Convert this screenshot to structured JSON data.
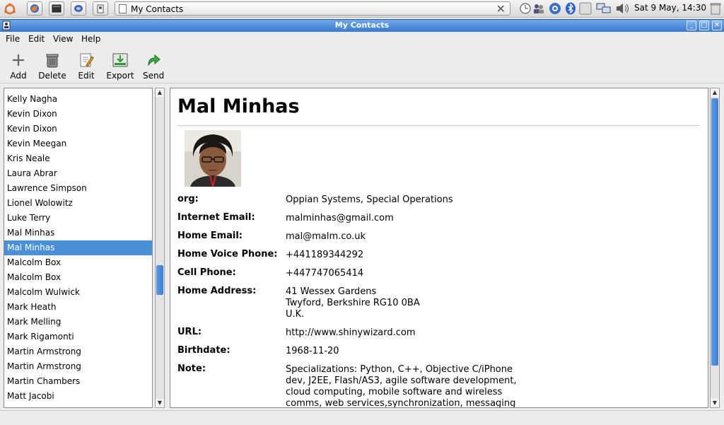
{
  "taskbar": {
    "window_title": "My Contacts",
    "clock": "Sat  9 May, 14:30"
  },
  "window": {
    "title": "My Contacts"
  },
  "menu": {
    "file": "File",
    "edit": "Edit",
    "view": "View",
    "help": "Help"
  },
  "toolbar": {
    "add": "Add",
    "delete": "Delete",
    "edit": "Edit",
    "export": "Export",
    "send": "Send"
  },
  "contacts": [
    "Kelly Nagha",
    "Kevin Dixon",
    "Kevin Dixon",
    "Kevin Meegan",
    "Kris Neale",
    "Laura Abrar",
    "Lawrence Simpson",
    "Lionel Wolowitz",
    "Luke Terry",
    "Mal Minhas",
    "Mal Minhas",
    "Malcolm Box",
    "Malcolm Box",
    "Malcolm Wulwick",
    "Mark Heath",
    "Mark Melling",
    "Mark Rigamonti",
    "Martin Armstrong",
    "Martin Armstrong",
    "Martin Chambers",
    "Matt Jacobi"
  ],
  "detail": {
    "name": "Mal Minhas",
    "fields": [
      {
        "label": "org:",
        "value": "Oppian Systems, Special Operations"
      },
      {
        "label": "Internet Email:",
        "value": "malminhas@gmail.com"
      },
      {
        "label": "Home Email:",
        "value": "mal@malm.co.uk"
      },
      {
        "label": "Home Voice Phone:",
        "value": "+441189344292"
      },
      {
        "label": "Cell Phone:",
        "value": "+447747065414"
      },
      {
        "label": "Home Address:",
        "value": "41 Wessex Gardens",
        "value2": "Twyford, Berkshire RG10 0BA",
        "value3": "U.K."
      },
      {
        "label": "URL:",
        "value": "http://www.shinywizard.com"
      },
      {
        "label": "Birthdate:",
        "value": "1968-11-20"
      },
      {
        "label": "Note:",
        "value": "Specializations: Python, C++, Objective C/iPhone",
        "value2": "dev, J2EE, Flash/AS3, agile software development,",
        "value3": "cloud computing, mobile software and wireless",
        "value4": "comms, web services,synchronization, messaging"
      }
    ]
  },
  "colors": {
    "selection": "#4a90d9",
    "titlebar": "#3a7bd0"
  }
}
